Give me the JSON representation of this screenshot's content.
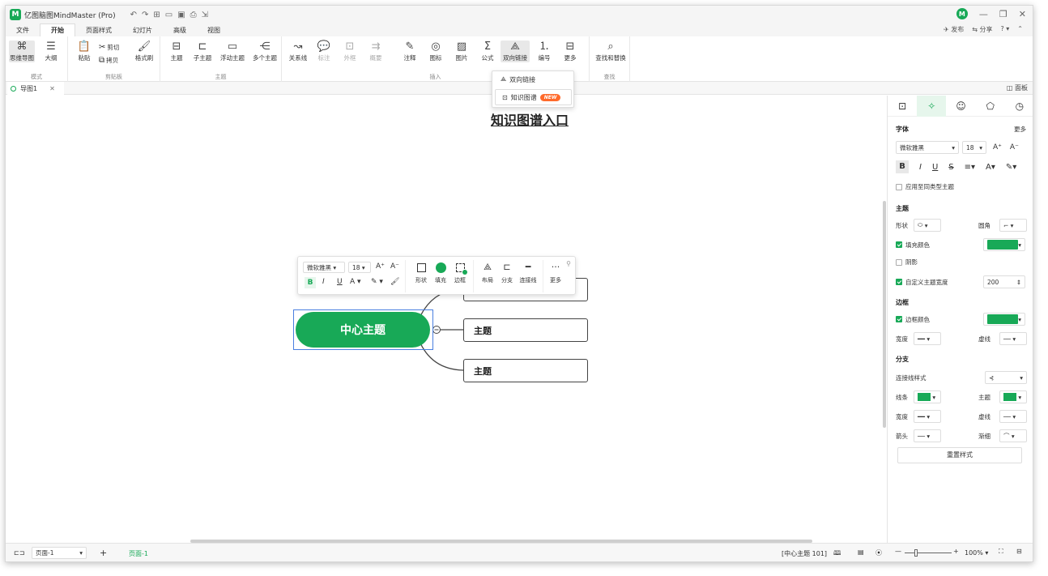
{
  "title_bar": {
    "app_title": "亿图脑图MindMaster (Pro)",
    "publish": "发布",
    "share": "分享"
  },
  "menu": {
    "items": [
      "文件",
      "开始",
      "页面样式",
      "幻灯片",
      "高级",
      "视图"
    ],
    "active": "开始"
  },
  "ribbon": {
    "mode": {
      "mindmap": "思维导图",
      "outline": "大纲",
      "label": "模式"
    },
    "clipboard": {
      "paste": "粘贴",
      "cut": "剪切",
      "copy": "拷贝",
      "format_painter": "格式刷",
      "label": "剪贴板"
    },
    "topic": {
      "main": "主题",
      "sub": "子主题",
      "floating": "浮动主题",
      "multi": "多个主题",
      "label": "主题"
    },
    "insert": {
      "relation": "关系线",
      "callout": "标注",
      "boundary": "外框",
      "summary": "概要",
      "note": "注释",
      "icon": "图标",
      "image": "图片",
      "formula": "公式",
      "bilink": "双向链接",
      "number": "编号",
      "more": "更多",
      "label": "插入"
    },
    "find": {
      "find_replace": "查找和替换",
      "label": "查找"
    }
  },
  "dropdown": {
    "bilink": "双向链接",
    "kg": "知识图谱",
    "badge": "NEW"
  },
  "annotation": "知识图谱入口",
  "tabs": {
    "doc": "导图1",
    "panel": "面板"
  },
  "canvas": {
    "central": "中心主题",
    "topics": [
      "主题",
      "主题",
      "主题"
    ]
  },
  "floatbar": {
    "font": "微软雅黑",
    "size": "18",
    "shape": "形状",
    "fill": "填充",
    "border": "边框",
    "layout": "布局",
    "branch": "分支",
    "connector": "连接线",
    "more": "更多"
  },
  "right_panel": {
    "font_section": "字体",
    "more": "更多",
    "font_name": "微软雅黑",
    "font_size": "18",
    "apply_same": "应用至同类型主题",
    "topic_section": "主题",
    "shape": "形状",
    "corner": "圆角",
    "fill_color": "填充颜色",
    "shadow": "阴影",
    "custom_width": "自定义主题宽度",
    "width_value": "200",
    "border_section": "边框",
    "border_color": "边框颜色",
    "width": "宽度",
    "dash": "虚线",
    "branch_section": "分支",
    "connector_style": "连接线样式",
    "line": "线条",
    "topic": "主题",
    "width2": "宽度",
    "dash2": "虚线",
    "arrow": "箭头",
    "taper": "渐细",
    "reset": "重置样式",
    "accent": "#18a957"
  },
  "status": {
    "page": "页面-1",
    "page_tab": "页面-1",
    "selection": "[中心主题 101]",
    "zoom": "100%"
  }
}
